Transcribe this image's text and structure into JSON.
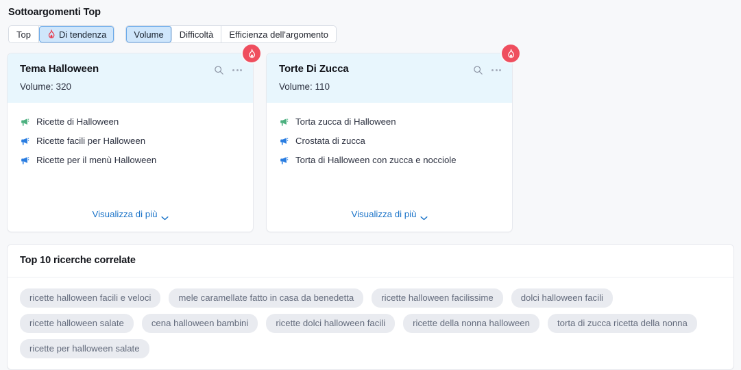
{
  "section": {
    "title": "Sottoargomenti Top"
  },
  "toolbar": {
    "group_sort": {
      "options": [
        {
          "label": "Top",
          "active": false,
          "icon": null
        },
        {
          "label": "Di tendenza",
          "active": true,
          "icon": "flame-icon"
        }
      ]
    },
    "group_metric": {
      "options": [
        {
          "label": "Volume",
          "active": true
        },
        {
          "label": "Difficoltà",
          "active": false
        },
        {
          "label": "Efficienza dell'argomento",
          "active": false
        }
      ]
    }
  },
  "cards": [
    {
      "title": "Tema Halloween",
      "volume_label": "Volume: 320",
      "badge": "flame-icon",
      "search_icon": "search-icon",
      "menu_icon": "ellipsis-icon",
      "keywords": [
        {
          "label": "Ricette di Halloween",
          "icon": "megaphone-icon",
          "color": "#4cb07f"
        },
        {
          "label": "Ricette facili per Halloween",
          "icon": "megaphone-icon",
          "color": "#2a7de1"
        },
        {
          "label": "Ricette per il menù Halloween",
          "icon": "megaphone-icon",
          "color": "#2a7de1"
        }
      ],
      "more_label": "Visualizza di più"
    },
    {
      "title": "Torte Di Zucca",
      "volume_label": "Volume: 110",
      "badge": "flame-icon",
      "search_icon": "search-icon",
      "menu_icon": "ellipsis-icon",
      "keywords": [
        {
          "label": "Torta zucca di Halloween",
          "icon": "megaphone-icon",
          "color": "#4cb07f"
        },
        {
          "label": "Crostata di zucca",
          "icon": "megaphone-icon",
          "color": "#2a7de1"
        },
        {
          "label": "Torta di Halloween con zucca e nocciole",
          "icon": "megaphone-icon",
          "color": "#2a7de1"
        }
      ],
      "more_label": "Visualizza di più"
    }
  ],
  "related": {
    "title": "Top 10 ricerche correlate",
    "chips": [
      "ricette halloween facili e veloci",
      "mele caramellate fatto in casa da benedetta",
      "ricette halloween facilissime",
      "dolci halloween facili",
      "ricette halloween salate",
      "cena halloween bambini",
      "ricette dolci halloween facili",
      "ricette della nonna halloween",
      "torta di zucca ricetta della nonna",
      "ricette per halloween salate"
    ]
  },
  "colors": {
    "accent_blue": "#1a73c8",
    "active_chip_bg": "#cfe6fb",
    "active_chip_border": "#6aa9e9",
    "card_header_bg": "#e8f6fd",
    "badge_red": "#ef4e5e",
    "keyword_green": "#4cb07f",
    "keyword_blue": "#2a7de1",
    "chip_bg": "#e9ebf0",
    "page_bg": "#f7f8fa"
  }
}
